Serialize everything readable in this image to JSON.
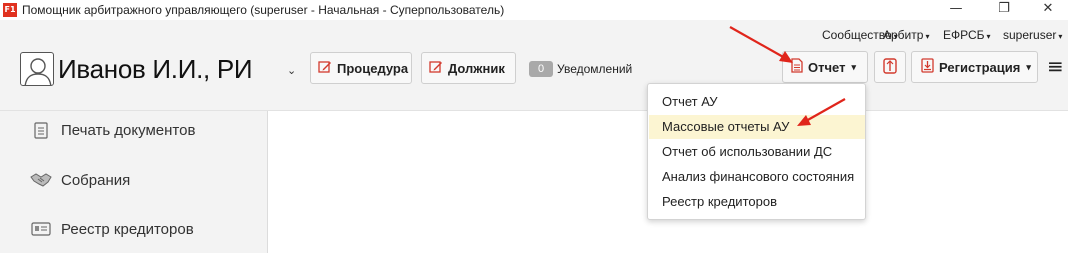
{
  "window": {
    "logo_text": "F1",
    "title": "Помощник арбитражного управляющего (superuser - Начальная - Суперпользователь)",
    "minimize": "—",
    "restore": "❐",
    "close": "✕"
  },
  "top_menu": [
    {
      "label": "Сообщество",
      "caret": "▾"
    },
    {
      "label": "Арбитр",
      "caret": "▾"
    },
    {
      "label": "ЕФРСБ",
      "caret": "▾"
    },
    {
      "label": "superuser",
      "caret": "▾"
    }
  ],
  "header": {
    "user_name": "Иванов И.И., РИ",
    "user_caret": "⌄",
    "procedure_label": "Процедура",
    "debtor_label": "Должник",
    "notifications_count": "0",
    "notifications_label": "Уведомлений",
    "report_label": "Отчет",
    "report_caret": "▾",
    "registration_label": "Регистрация",
    "registration_caret": "▾",
    "menu_icon": "≡"
  },
  "sidebar": {
    "items": [
      {
        "label": "Печать документов",
        "icon": "document-icon"
      },
      {
        "label": "Собрания",
        "icon": "handshake-icon"
      },
      {
        "label": "Реестр кредиторов",
        "icon": "id-card-icon"
      }
    ]
  },
  "report_dropdown": {
    "items": [
      {
        "label": "Отчет АУ",
        "highlighted": false
      },
      {
        "label": "Массовые отчеты АУ",
        "highlighted": true
      },
      {
        "label": "Отчет об использовании ДС",
        "highlighted": false
      },
      {
        "label": "Анализ финансового состояния",
        "highlighted": false
      },
      {
        "label": "Реестр кредиторов",
        "highlighted": false
      }
    ]
  },
  "colors": {
    "accent_red": "#e0311f",
    "highlight": "#fcf5d2",
    "panel_bg": "#f3f3f3"
  }
}
